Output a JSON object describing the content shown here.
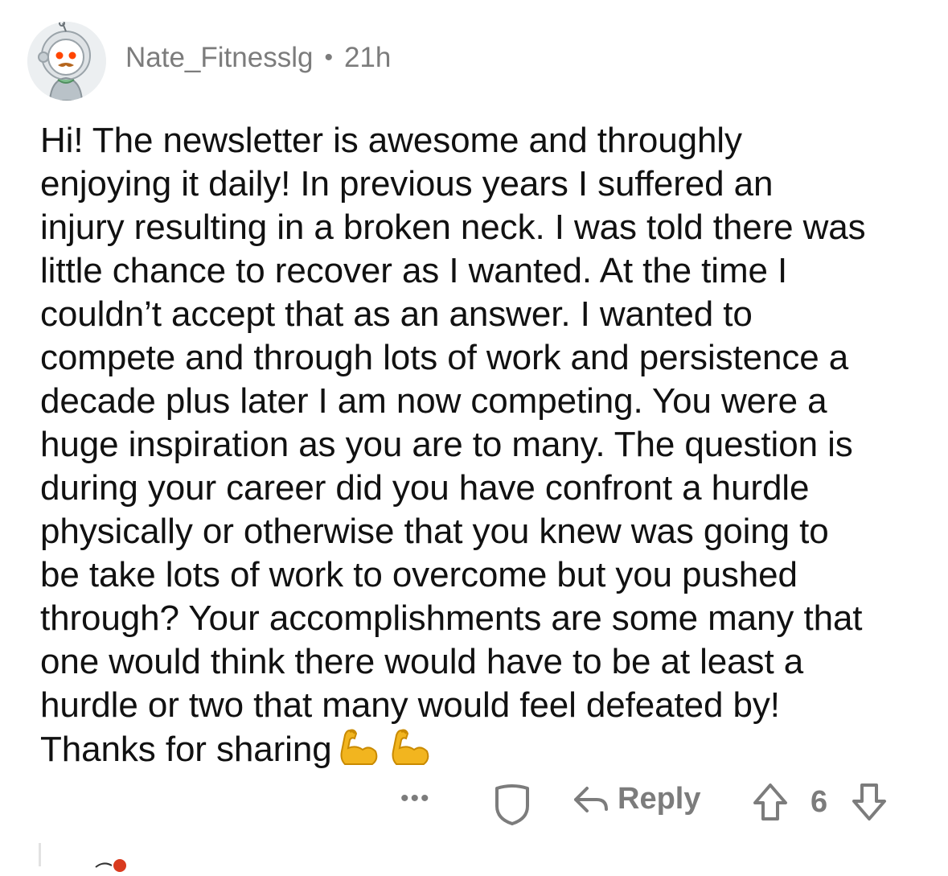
{
  "comment": {
    "username": "Nate_Fitnesslg",
    "separator": "•",
    "time": "21h",
    "body_lines": [
      "Hi! The newsletter is awesome and throughly",
      "enjoying it daily! In previous years I suffered an",
      "injury resulting in a broken neck. I was told there was",
      "little chance to recover as I wanted. At the time I",
      "couldn’t accept that as an answer. I wanted to",
      "compete and through lots of work and persistence a",
      "decade plus later I am now competing. You were a",
      "huge inspiration as you are to many. The question is",
      "during your career did you have confront a hurdle",
      "physically or otherwise that you knew was going to",
      "be take lots of work to overcome but you pushed",
      "through? Your accomplishments are some many that",
      "one would think there would have to be at least a",
      "hurdle or two that many would feel defeated by!",
      "Thanks for sharing"
    ],
    "emojis": [
      "flexed-biceps",
      "flexed-biceps"
    ]
  },
  "actions": {
    "more_label": "•••",
    "reply_label": "Reply",
    "score": "6"
  },
  "icons": {
    "avatar": "snoo-astronaut-avatar-icon",
    "award": "award-shield-icon",
    "reply": "reply-arrow-icon",
    "upvote": "upvote-arrow-icon",
    "downvote": "downvote-arrow-icon"
  },
  "colors": {
    "meta_text": "#7c7c7c",
    "body_text": "#111111",
    "emoji": "#f2b51f"
  }
}
